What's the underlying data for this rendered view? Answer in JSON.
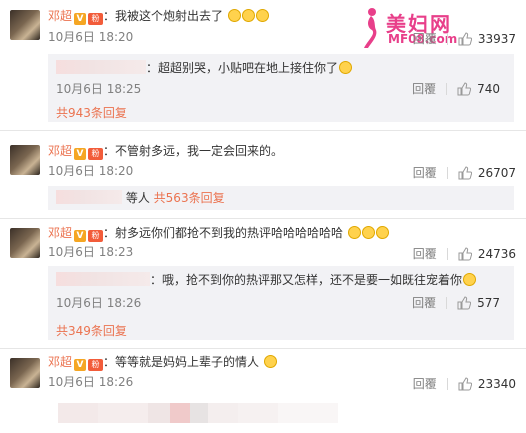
{
  "watermark": {
    "title": "美妇网",
    "subtitle": "MF08.com"
  },
  "comments": [
    {
      "user": "邓超",
      "text": "：我被这个炮射出去了",
      "time": "10月6日 18:20",
      "reply_label": "回覆",
      "likes": "33937",
      "sub": {
        "text": "：超超别哭，小贴吧在地上接住你了",
        "time": "10月6日 18:25",
        "reply_label": "回覆",
        "likes": "740"
      },
      "more": "共943条回复"
    },
    {
      "user": "邓超",
      "text": "：不管射多远，我一定会回来的。",
      "time": "10月6日 18:20",
      "reply_label": "回覆",
      "likes": "26707",
      "summary_suffix": "等人",
      "summary_link": "共563条回复"
    },
    {
      "user": "邓超",
      "text": "：射多远你们都抢不到我的热评哈哈哈哈哈哈",
      "time": "10月6日 18:23",
      "reply_label": "回覆",
      "likes": "24736",
      "sub": {
        "text": "：哦，抢不到你的热评那又怎样，还不是要一如既往宠着你",
        "time": "10月6日 18:26",
        "reply_label": "回覆",
        "likes": "577"
      },
      "more": "共349条回复"
    },
    {
      "user": "邓超",
      "text": "：等等就是妈妈上辈子的情人",
      "time": "10月6日 18:26",
      "reply_label": "回覆",
      "likes": "23340"
    }
  ],
  "colors": {
    "username": "#eb7350",
    "link": "#eb7350",
    "subbox_bg": "#f2f2f5",
    "meta": "#808080"
  }
}
